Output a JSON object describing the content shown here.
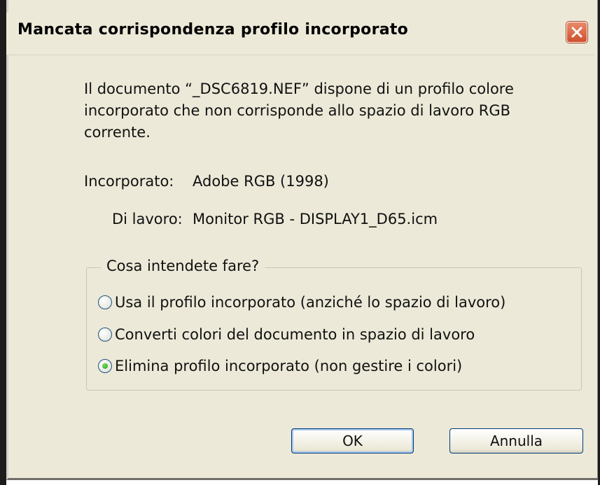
{
  "window": {
    "title": "Mancata corrispondenza profilo incorporato"
  },
  "message": {
    "line1": "Il documento “_DSC6819.NEF” dispone di un profilo colore",
    "line2": "incorporato che non corrisponde allo spazio di lavoro RGB",
    "line3": "corrente."
  },
  "profile": {
    "embedded_label": "Incorporato:",
    "embedded_value": "Adobe RGB (1998)",
    "working_label": "Di lavoro:",
    "working_value": "Monitor RGB - DISPLAY1_D65.icm"
  },
  "options": {
    "legend": "Cosa intendete fare?",
    "items": [
      {
        "label": "Usa il profilo incorporato (anziché lo spazio di lavoro)",
        "selected": false
      },
      {
        "label": "Converti colori del documento in spazio di lavoro",
        "selected": false
      },
      {
        "label": "Elimina profilo incorporato (non gestire i colori)",
        "selected": true
      }
    ]
  },
  "buttons": {
    "ok": "OK",
    "cancel": "Annulla"
  },
  "colors": {
    "dialog_bg": "#ece9d8",
    "close_button": "#d0502d",
    "radio_selected": "#21a121"
  }
}
